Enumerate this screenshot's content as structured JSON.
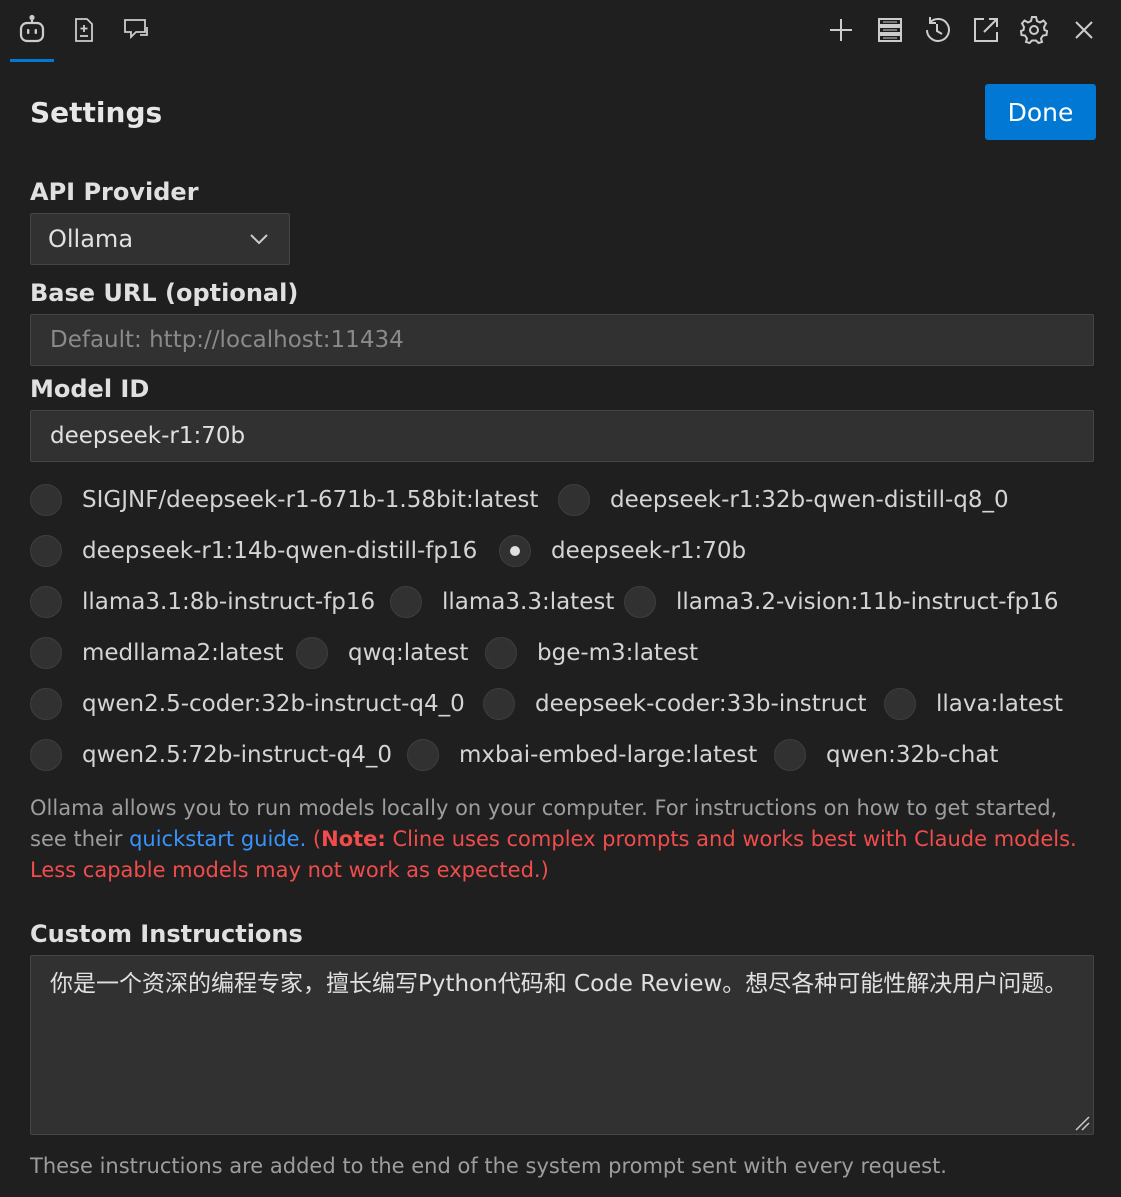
{
  "toolbar": {
    "left_icons": [
      "robot-icon",
      "add-file-icon",
      "chat-icon"
    ],
    "right_icons": [
      "plus-icon",
      "server-icon",
      "history-icon",
      "open-external-icon",
      "gear-icon",
      "close-icon"
    ]
  },
  "header": {
    "title": "Settings",
    "done_label": "Done"
  },
  "api_provider": {
    "label": "API Provider",
    "selected": "Ollama"
  },
  "base_url": {
    "label": "Base URL (optional)",
    "value": "",
    "placeholder": "Default: http://localhost:11434"
  },
  "model_id": {
    "label": "Model ID",
    "value": "deepseek-r1:70b"
  },
  "models": {
    "row1": [
      "SIGJNF/deepseek-r1-671b-1.58bit:latest",
      "deepseek-r1:32b-qwen-distill-q8_0"
    ],
    "row2": [
      "deepseek-r1:14b-qwen-distill-fp16",
      "deepseek-r1:70b"
    ],
    "row3": [
      "llama3.1:8b-instruct-fp16",
      "llama3.3:latest",
      "llama3.2-vision:11b-instruct-fp16"
    ],
    "row4": [
      "medllama2:latest",
      "qwq:latest",
      "bge-m3:latest"
    ],
    "row5": [
      "qwen2.5-coder:32b-instruct-q4_0",
      "deepseek-coder:33b-instruct",
      "llava:latest"
    ],
    "row6": [
      "qwen2.5:72b-instruct-q4_0",
      "mxbai-embed-large:latest",
      "qwen:32b-chat"
    ],
    "selected": "deepseek-r1:70b"
  },
  "description": {
    "text1": "Ollama allows you to run models locally on your computer. For instructions on how to get started, see their ",
    "link": "quickstart guide.",
    "open_paren": " (",
    "note_label": "Note:",
    "note_text": " Cline uses complex prompts and works best with Claude models. Less capable models may not work as expected.)"
  },
  "custom_instructions": {
    "label": "Custom Instructions",
    "value": "你是一个资深的编程专家，擅长编写Python代码和 Code Review。想尽各种可能性解决用户问题。",
    "footnote": "These instructions are added to the end of the system prompt sent with every request."
  },
  "colors": {
    "accent": "#0078d4",
    "link": "#3794ff",
    "warning": "#f14c4c",
    "background": "#1f1f1f"
  }
}
